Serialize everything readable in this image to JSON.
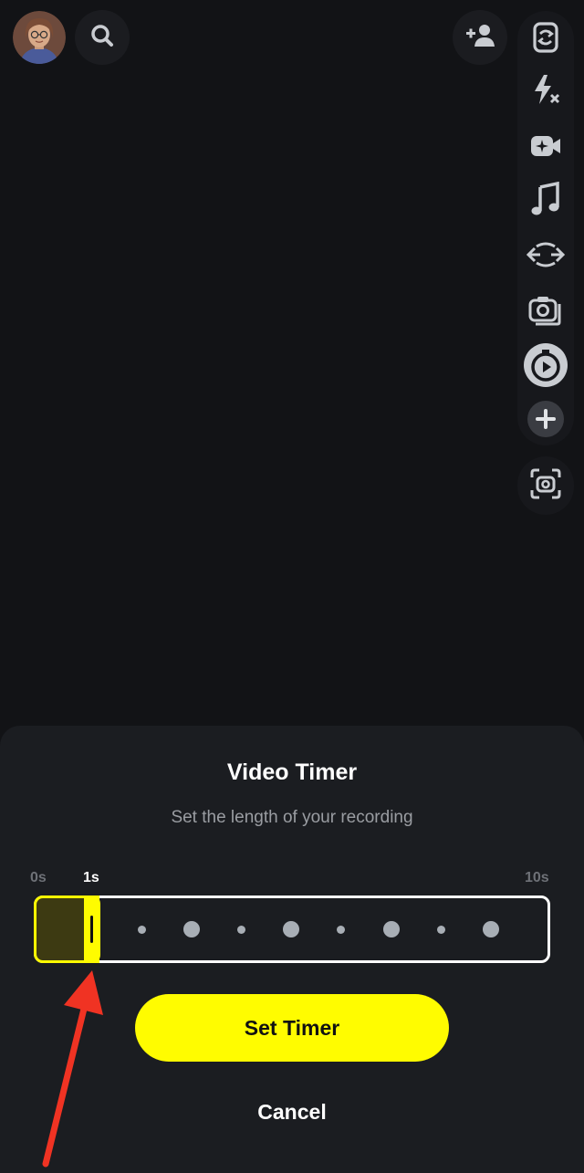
{
  "toolbar": {
    "icons": [
      "avatar",
      "search-icon",
      "add-friend-icon",
      "flip-camera-icon",
      "flash-off-icon",
      "video-effects-icon",
      "music-icon",
      "dual-camera-icon",
      "multi-snap-icon",
      "timer-icon",
      "more-icon",
      "scan-icon"
    ]
  },
  "timer_sheet": {
    "title": "Video Timer",
    "subtitle": "Set the length of your recording",
    "min_label": "0s",
    "current_label": "1s",
    "max_label": "10s",
    "selected_seconds": 1,
    "max_seconds": 10,
    "set_button": "Set Timer",
    "cancel_button": "Cancel"
  },
  "colors": {
    "accent": "#fffc00",
    "background": "#121316",
    "sheet": "#1b1d21"
  }
}
